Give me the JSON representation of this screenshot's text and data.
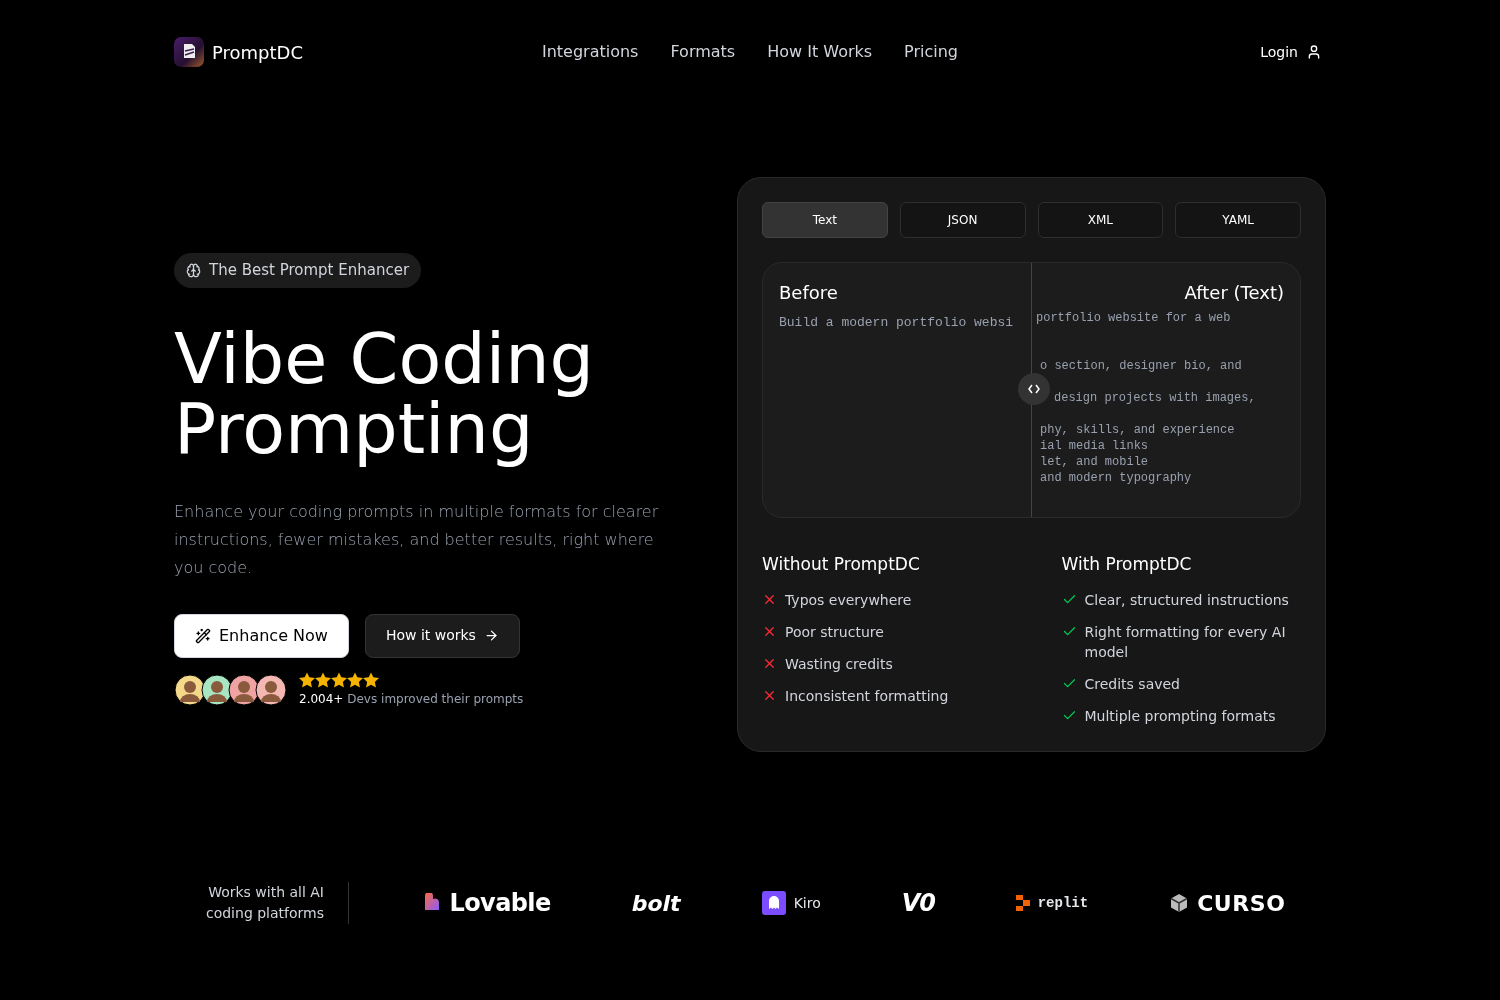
{
  "nav": {
    "brand": "PromptDC",
    "links": [
      "Integrations",
      "Formats",
      "How It Works",
      "Pricing"
    ],
    "login": "Login"
  },
  "hero": {
    "badge": "The Best Prompt Enhancer",
    "title_lines": [
      "Vibe Coding",
      "Prompting"
    ],
    "description": "Enhance your coding prompts in multiple formats for clearer instructions, fewer mistakes, and better results, right where you code.",
    "primary_button": "Enhance Now",
    "secondary_button": "How it works",
    "stars": 5,
    "proof_count": "2.004+",
    "proof_text": "Devs improved their prompts",
    "avatars": [
      {
        "color": "#f5d98a"
      },
      {
        "color": "#a8e6c3"
      },
      {
        "color": "#f0a3a3"
      },
      {
        "color": "#f5b7b1"
      }
    ]
  },
  "demo": {
    "tabs": [
      {
        "label": "Text",
        "selected": true
      },
      {
        "label": "JSON",
        "selected": false
      },
      {
        "label": "XML",
        "selected": false
      },
      {
        "label": "YAML",
        "selected": false
      }
    ],
    "before_title": "Before",
    "before_text": "Build a modern portfolio websi",
    "after_title": "After (Text)",
    "after_paragraphs": [
      [
        "portfolio website for a web"
      ],
      [
        "o section, designer bio, and"
      ],
      [
        "design projects with images,"
      ],
      [
        "phy, skills, and experience",
        "ial media links",
        "let, and mobile",
        "and modern typography"
      ]
    ],
    "without": {
      "title": "Without PromptDC",
      "items": [
        "Typos everywhere",
        "Poor structure",
        "Wasting credits",
        "Inconsistent formatting"
      ]
    },
    "with": {
      "title": "With PromptDC",
      "items": [
        "Clear, structured instructions",
        "Right formatting for every AI model",
        "Credits saved",
        "Multiple prompting formats"
      ]
    }
  },
  "platforms": {
    "label": "Works with all AI coding platforms",
    "logos": [
      {
        "kind": "lovable",
        "name": "Lovable"
      },
      {
        "kind": "bolt",
        "name": "bolt"
      },
      {
        "kind": "kiro",
        "name": "Kiro"
      },
      {
        "kind": "v0",
        "name": "V0"
      },
      {
        "kind": "replit",
        "name": "replit"
      },
      {
        "kind": "cursor",
        "name": "CURSO"
      }
    ]
  }
}
